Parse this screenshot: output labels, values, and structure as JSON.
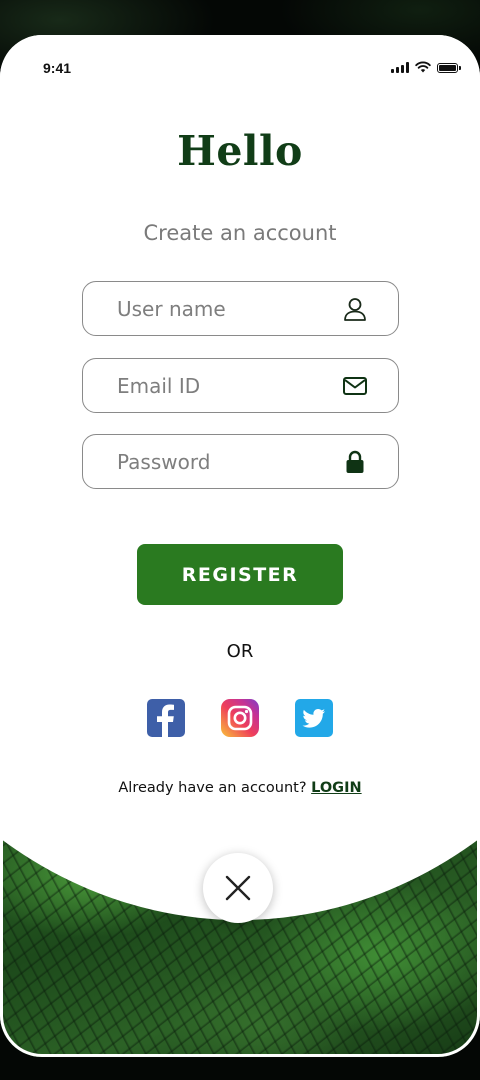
{
  "status_bar": {
    "time": "9:41",
    "icons": [
      "cellular-signal-icon",
      "wifi-icon",
      "battery-icon"
    ]
  },
  "logo": {
    "text": "Hello"
  },
  "subtitle": "Create an account",
  "form": {
    "username": {
      "placeholder": "User name",
      "value": "",
      "icon": "user-icon"
    },
    "email": {
      "placeholder": "Email ID",
      "value": "",
      "icon": "envelope-icon"
    },
    "password": {
      "placeholder": "Password",
      "value": "",
      "icon": "lock-icon"
    }
  },
  "register_button": {
    "label": "REGISTER"
  },
  "divider_text": "OR",
  "social": [
    {
      "name": "facebook",
      "icon": "facebook-icon"
    },
    {
      "name": "instagram",
      "icon": "instagram-icon"
    },
    {
      "name": "twitter",
      "icon": "twitter-icon"
    }
  ],
  "footer": {
    "prompt": "Already have an account?",
    "login_label": "LOGIN"
  },
  "close_button": {
    "icon": "close-icon"
  },
  "colors": {
    "brand_dark_green": "#113d17",
    "button_green": "#2a7a20",
    "facebook_blue": "#3e5fa8",
    "twitter_blue": "#22a8e8"
  }
}
